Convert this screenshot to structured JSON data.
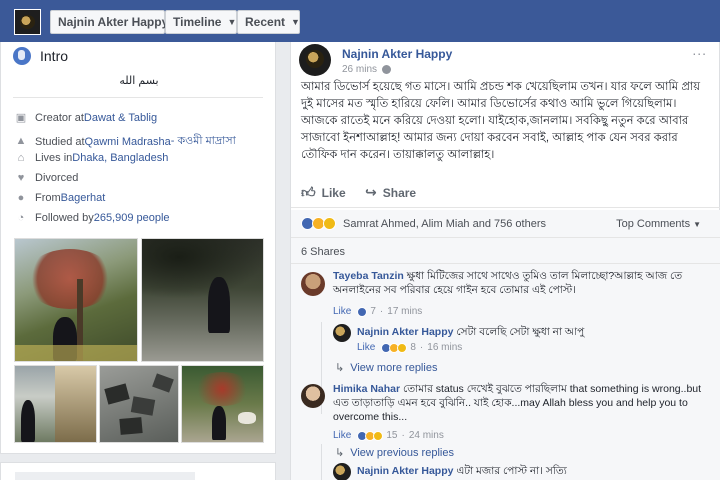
{
  "topbar": {
    "profile_name": "Najnin Akter Happy",
    "timeline_label": "Timeline",
    "recent_label": "Recent",
    "bg_color": "#3b5998"
  },
  "intro": {
    "title": "Intro",
    "bio": "بسم الله",
    "rows": [
      {
        "icon": "briefcase-icon",
        "prefix": "Creator at ",
        "link": "Dawat & Tablig",
        "suffix": ""
      },
      {
        "icon": "graduation-cap-icon",
        "prefix": "Studied at ",
        "link": "Qawmi Madrasha",
        "suffix": " - কওমী মাদ্রাসা"
      },
      {
        "icon": "home-icon",
        "prefix": "Lives in ",
        "link": "Dhaka, Bangladesh",
        "suffix": ""
      },
      {
        "icon": "heart-icon",
        "prefix": "Divorced",
        "link": "",
        "suffix": ""
      },
      {
        "icon": "location-pin-icon",
        "prefix": "From ",
        "link": "Bagerhat",
        "suffix": ""
      },
      {
        "icon": "rss-icon",
        "prefix": "Followed by ",
        "link": "265,909 people",
        "suffix": ""
      }
    ]
  },
  "post": {
    "author": "Najnin Akter Happy",
    "time": "26 mins",
    "more": "...",
    "text": "আমার ডিভোর্স হয়েছে গত মাসে। আমি প্রচন্ড শক খেয়েছিলাম তখন। যার ফলে আমি প্রায় দুই মাসের মত স্মৃতি হারিয়ে ফেলি। আমার ডিভোর্সের কথাও আমি ভুলে গিয়েছিলাম। আজকে রাতেই মনে করিয়ে দেওয়া হলো। যাইহোক,জানলাম। সবকিছু নতুন করে আবার সাজাবো ইনশাআল্লাহ! আমার জন্য দোয়া করবেন সবাই, আল্লাহ পাক যেন সবর করার তৌফিক দান করেন। তায়াক্কালতু আলাল্লাহ।",
    "like_label": "Like",
    "share_label": "Share",
    "reactions_text": "Samrat Ahmed, Alim Miah and 756 others",
    "top_comments_label": "Top Comments",
    "shares_text": "6 Shares"
  },
  "comments": [
    {
      "name": "Tayeba Tanzin",
      "text": "ক্ষুধা মিটিজের সাথে সাথেও তুমিও তাল মিলাচ্ছো?আল্লাহ আজ তে অনলাইনের সব পরিবার হেয়ে গাইন হবে তোমার এই পোস্ট।",
      "like": "Like",
      "count": "7",
      "time": "17 mins",
      "reply": {
        "name": "Najnin Akter Happy",
        "text": "সেটা বলেছি সেটা ক্ষুধা না আপু",
        "like": "Like",
        "count": "8",
        "time": "16 mins"
      },
      "view_more": "View more replies"
    },
    {
      "name": "Himika Nahar",
      "text": "তোমার status দেখেই বুঝতে পারছিলাম that something is wrong..but এত তাড়াতাড়ি এমন হবে বুঝিনি.. যাই হোক...may Allah bless you and help you to overcome this...",
      "like": "Like",
      "count": "15",
      "time": "24 mins",
      "view_previous": "View previous replies",
      "reply": {
        "name": "Najnin Akter Happy",
        "text": "এটা মজার পোস্ট না। সত্যি"
      }
    }
  ]
}
